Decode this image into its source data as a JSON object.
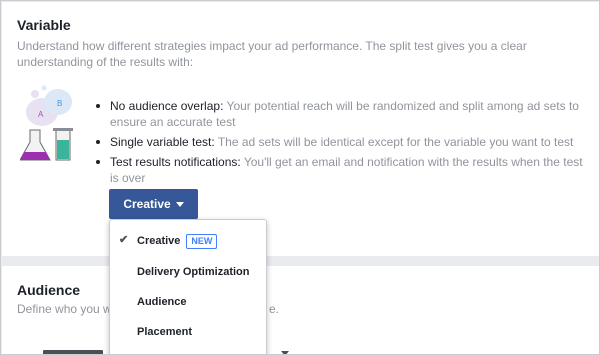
{
  "variable_section": {
    "title": "Variable",
    "description": "Understand how different strategies impact your ad performance. The split test gives you a clear understanding of the results with:",
    "illustration_labels": {
      "a": "A",
      "b": "B"
    },
    "bullets": [
      {
        "bold": "No audience overlap:",
        "text": " Your potential reach will be randomized and split among ad sets to ensure an accurate test"
      },
      {
        "bold": "Single variable test:",
        "text": " The ad sets will be identical except for the variable you want to test"
      },
      {
        "bold": "Test results notifications:",
        "text": " You'll get an email and notification with the results when the test is over"
      }
    ],
    "dropdown_button": {
      "label": "Creative"
    }
  },
  "dropdown_menu": {
    "items": [
      {
        "label": "Creative",
        "selected": true,
        "badge": "NEW"
      },
      {
        "label": "Delivery Optimization",
        "selected": false
      },
      {
        "label": "Audience",
        "selected": false
      },
      {
        "label": "Placement",
        "selected": false
      }
    ]
  },
  "audience_section": {
    "title": "Audience",
    "description_left": "Define who you wa",
    "description_right": "e."
  },
  "colors": {
    "primary_button": "#365899",
    "badge": "#4080ff",
    "muted_text": "#90949c",
    "text": "#1d2129"
  },
  "icons": [
    "check-icon",
    "caret-down-icon",
    "lab-flask-icon"
  ]
}
